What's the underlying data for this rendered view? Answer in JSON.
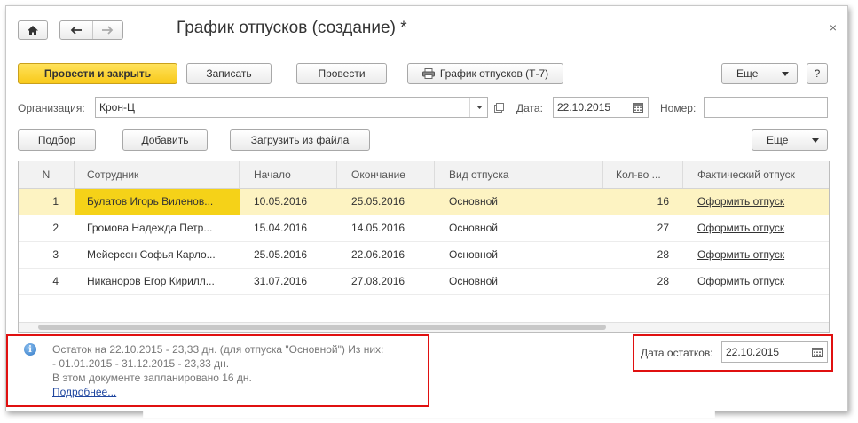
{
  "window": {
    "title": "График отпусков (создание) *"
  },
  "toolbar": {
    "post_close": "Провести и закрыть",
    "save": "Записать",
    "post": "Провести",
    "print": "График отпусков (Т-7)",
    "more": "Еще",
    "help": "?"
  },
  "form": {
    "org_label": "Организация:",
    "org_value": "Крон-Ц",
    "date_label": "Дата:",
    "date_value": "22.10.2015",
    "number_label": "Номер:",
    "number_value": ""
  },
  "table_toolbar": {
    "select": "Подбор",
    "add": "Добавить",
    "load": "Загрузить из файла",
    "more": "Еще"
  },
  "table": {
    "columns": [
      "N",
      "Сотрудник",
      "Начало",
      "Окончание",
      "Вид отпуска",
      "Кол-во ...",
      "Фактический отпуск"
    ],
    "rows": [
      {
        "n": "1",
        "employee": "Булатов Игорь Виленов...",
        "start": "10.05.2016",
        "end": "25.05.2016",
        "type": "Основной",
        "days": "16",
        "action": "Оформить отпуск"
      },
      {
        "n": "2",
        "employee": "Громова Надежда Петр...",
        "start": "15.04.2016",
        "end": "14.05.2016",
        "type": "Основной",
        "days": "27",
        "action": "Оформить отпуск"
      },
      {
        "n": "3",
        "employee": "Мейерсон Софья Карло...",
        "start": "25.05.2016",
        "end": "22.06.2016",
        "type": "Основной",
        "days": "28",
        "action": "Оформить отпуск"
      },
      {
        "n": "4",
        "employee": "Никаноров Егор Кирилл...",
        "start": "31.07.2016",
        "end": "27.08.2016",
        "type": "Основной",
        "days": "28",
        "action": "Оформить отпуск"
      }
    ]
  },
  "info": {
    "line1": "Остаток на 22.10.2015 - 23,33 дн. (для отпуска \"Основной\") Из них:",
    "line2": "- 01.01.2015 - 31.12.2015 - 23,33 дн.",
    "line3": "В этом документе запланировано 16 дн.",
    "more_link": "Подробнее..."
  },
  "balance": {
    "label": "Дата остатков:",
    "value": "22.10.2015"
  },
  "colors": {
    "accent": "#f8c91a",
    "selected_row": "#fdf3c2",
    "highlight_box": "#e01010",
    "link": "#2047a0"
  }
}
